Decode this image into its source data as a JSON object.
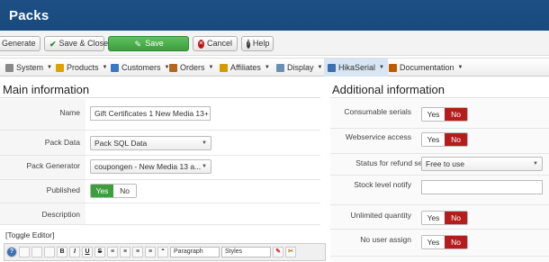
{
  "header": {
    "title": "Packs"
  },
  "toolbar": {
    "generate": "Generate",
    "save_close": "Save & Close",
    "save": "Save",
    "cancel": "Cancel",
    "help": "Help"
  },
  "menu": [
    {
      "label": "System",
      "icon": "wrench-icon",
      "color": "#666666"
    },
    {
      "label": "Products",
      "icon": "box-icon",
      "color": "#e0a000"
    },
    {
      "label": "Customers",
      "icon": "users-icon",
      "color": "#3a78c2"
    },
    {
      "label": "Orders",
      "icon": "cart-icon",
      "color": "#b5651d"
    },
    {
      "label": "Affiliates",
      "icon": "affiliate-icon",
      "color": "#d49b00"
    },
    {
      "label": "Display",
      "icon": "display-icon",
      "color": "#6a8fb5"
    },
    {
      "label": "HikaSerial",
      "icon": "serial-icon",
      "color": "#3a6fb0"
    },
    {
      "label": "Documentation",
      "icon": "book-icon",
      "color": "#c05a00"
    }
  ],
  "main": {
    "title": "Main information",
    "name_label": "Name",
    "name_value": "Gift Certificates 1 New Media 13+",
    "pack_data_label": "Pack Data",
    "pack_data_value": "Pack SQL Data",
    "pack_generator_label": "Pack Generator",
    "pack_generator_value": "coupongen - New Media 13 a...",
    "published_label": "Published",
    "published_yes": "Yes",
    "published_no": "No",
    "description_label": "Description",
    "toggle_editor": "[Toggle Editor]",
    "editor_paragraph": "Paragraph",
    "editor_styles": "Styles"
  },
  "additional": {
    "title": "Additional information",
    "consumable_label": "Consumable serials",
    "webservice_label": "Webservice access",
    "refund_label": "Status for refund serials",
    "refund_value": "Free to use",
    "stock_label": "Stock level notify",
    "unlimited_label": "Unlimited quantity",
    "no_user_label": "No user assign",
    "yes": "Yes",
    "no": "No"
  },
  "colors": {
    "header": "#1c4f85",
    "green": "#3e9e3e",
    "red": "#b51d1d",
    "active_menu": "#d7e6f2"
  }
}
